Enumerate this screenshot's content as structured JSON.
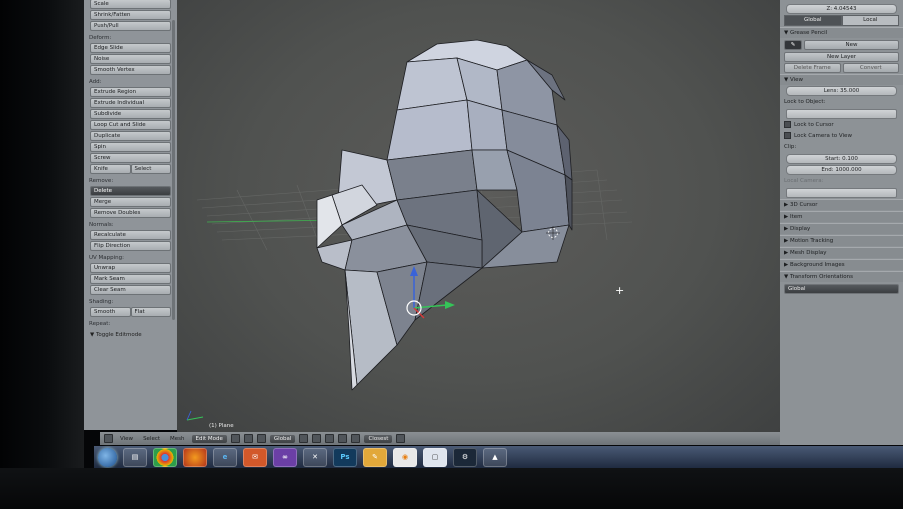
{
  "toolshelf": {
    "top_buttons": [
      "Scale",
      "Shrink/Fatten",
      "Push/Pull"
    ],
    "deform_label": "Deform:",
    "deform_buttons": [
      "Edge Slide",
      "Noise",
      "Smooth Vertex"
    ],
    "add_label": "Add:",
    "add_buttons": [
      "Extrude Region",
      "Extrude Individual",
      "Subdivide",
      "Loop Cut and Slide",
      "Duplicate",
      "Spin",
      "Screw"
    ],
    "knife_label": "Knife",
    "select_label": "Select",
    "remove_label": "Remove:",
    "delete_label": "Delete",
    "remove_buttons": [
      "Merge",
      "Remove Doubles"
    ],
    "normals_label": "Normals:",
    "normals_buttons": [
      "Recalculate",
      "Flip Direction"
    ],
    "uv_label": "UV Mapping:",
    "uv_buttons": [
      "Unwrap",
      "Mark Seam",
      "Clear Seam"
    ],
    "shading_label": "Shading:",
    "smooth_label": "Smooth",
    "flat_label": "Flat",
    "repeat_label": "Repeat:",
    "toggle_label": "▼ Toggle Editmode"
  },
  "viewport": {
    "object_label": "(1) Plane"
  },
  "header": {
    "menu_items": [
      "View",
      "Select",
      "Mesh"
    ],
    "mode": "Edit Mode",
    "orientation": "Global",
    "snap": "Closest"
  },
  "properties": {
    "z_value": "Z: 4.04543",
    "tab_global": "Global",
    "tab_local": "Local",
    "grease_pencil": "▼ Grease Pencil",
    "new_label": "New",
    "new_layer": "New Layer",
    "delete_frame": "Delete Frame",
    "convert": "Convert",
    "view_head": "▼ View",
    "lens": "Lens: 35.000",
    "lock_to_object": "Lock to Object:",
    "lock_to_cursor": "Lock to Cursor",
    "lock_camera": "Lock Camera to View",
    "clip_label": "Clip:",
    "clip_start": "Start: 0.100",
    "clip_end": "End: 1000.000",
    "local_camera": "Local Camera:",
    "panels": [
      "▶ 3D Cursor",
      "▶ Item",
      "▶ Display",
      "▶ Motion Tracking",
      "▶ Mesh Display",
      "▶ Background Images"
    ],
    "transform_orient": "▼ Transform Orientations",
    "global_select": "Global"
  },
  "taskbar": {
    "icons": [
      "start-orb",
      "file-explorer",
      "chrome",
      "firefox",
      "internet-explorer",
      "outlook",
      "visual-studio",
      "tools",
      "photoshop",
      "notes",
      "blender",
      "window",
      "steam",
      "landscape"
    ]
  }
}
